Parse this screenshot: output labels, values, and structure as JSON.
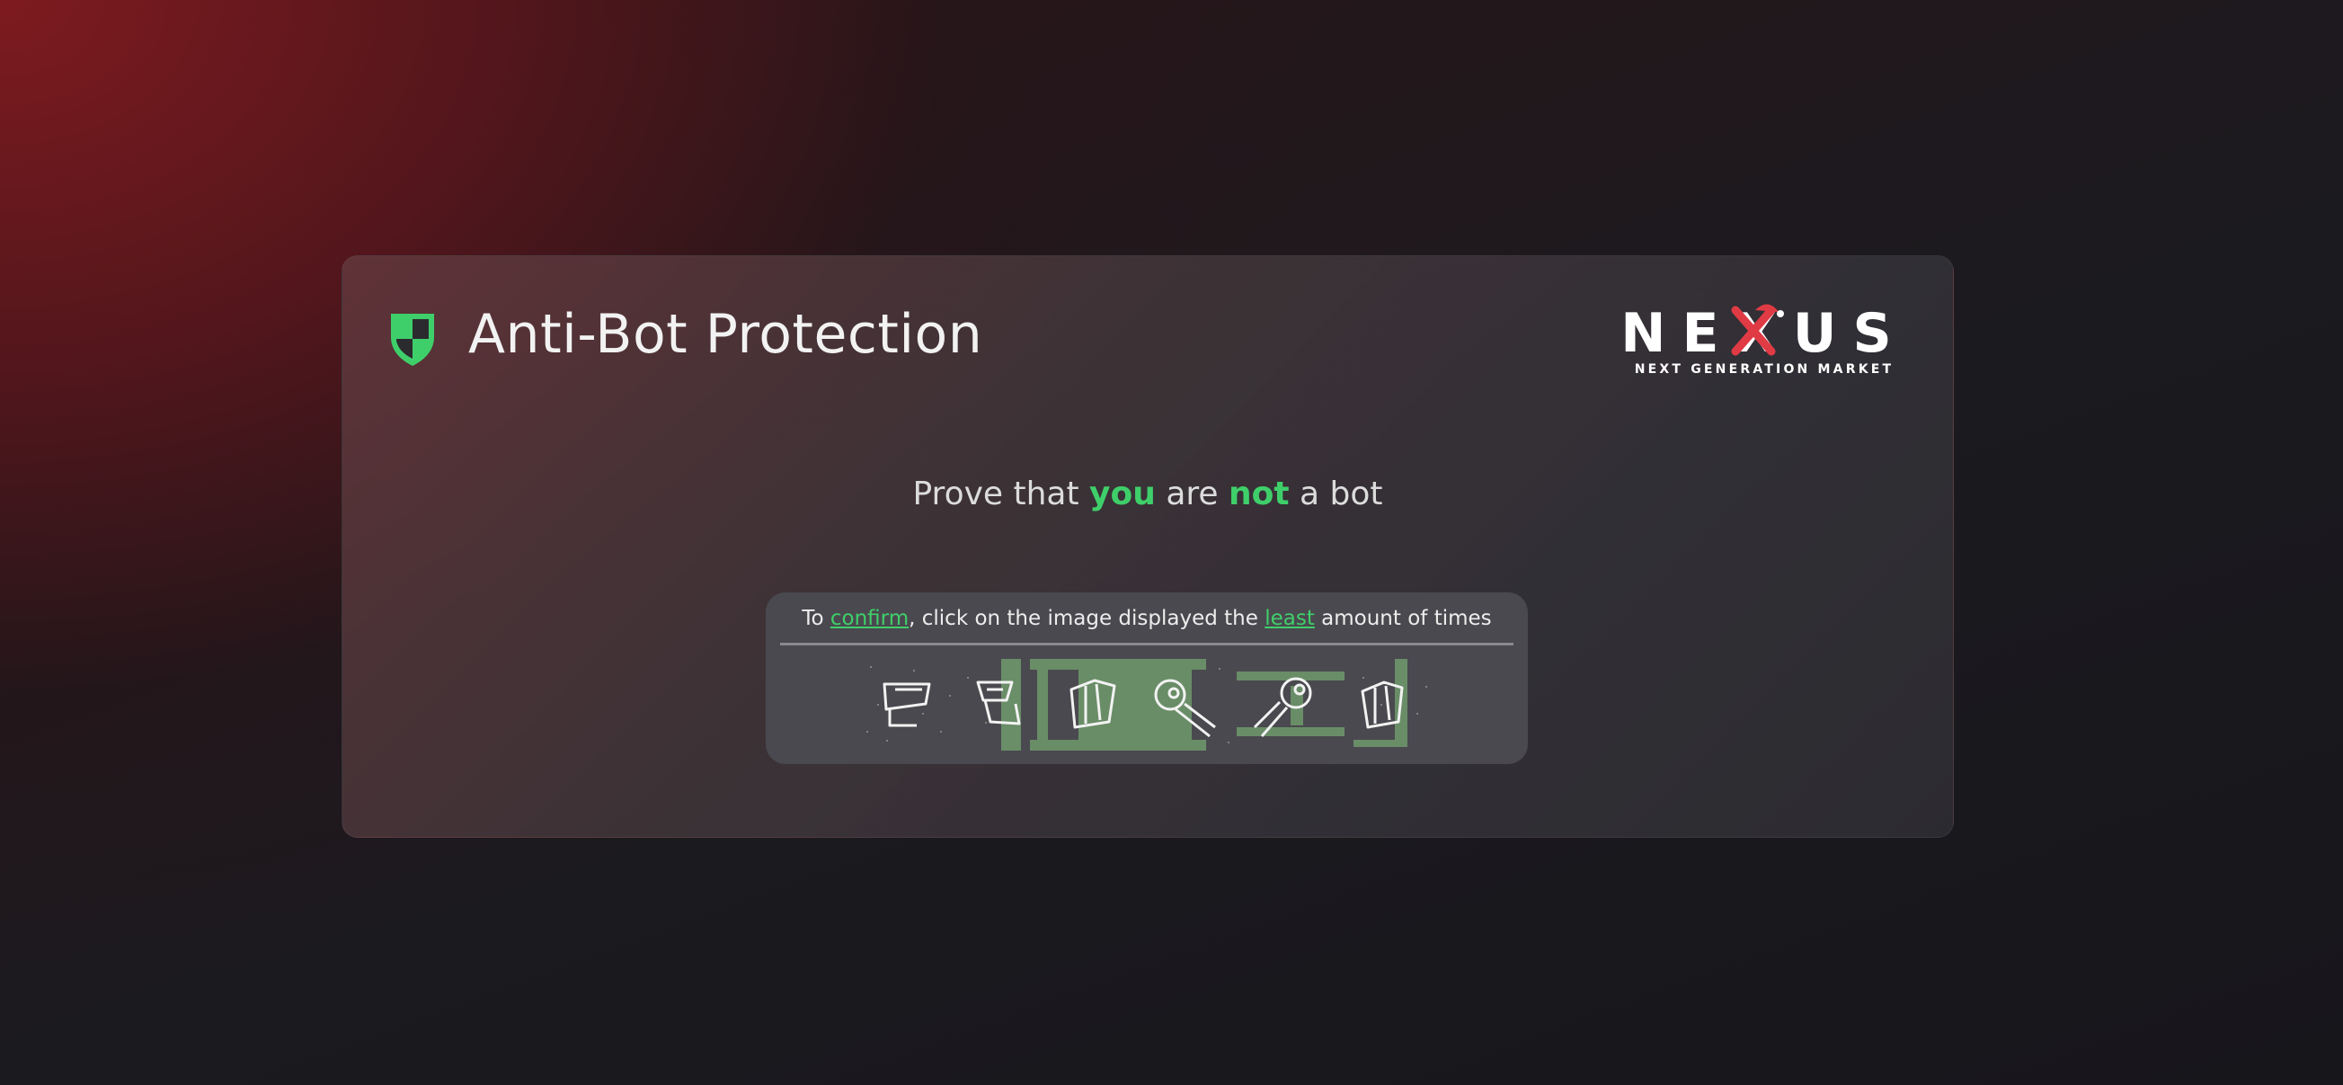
{
  "header": {
    "title": "Anti-Bot Protection",
    "shield_icon": "shield-icon",
    "accent_color": "#3fcf6a"
  },
  "logo": {
    "name": "NEXUS",
    "tagline": "NEXT GENERATION MARKET"
  },
  "prompt": {
    "part1": "Prove that ",
    "you": "you",
    "part2": " are ",
    "not": "not",
    "part3": " a bot"
  },
  "captcha": {
    "part1": "To ",
    "confirm": "confirm",
    "part2": ", click on the image displayed the ",
    "least": "least",
    "part3": " amount of times",
    "icons": [
      "pedestal-icon",
      "pedestal-icon",
      "scroll-icon",
      "comet-icon",
      "comet-icon",
      "scroll-icon"
    ]
  }
}
